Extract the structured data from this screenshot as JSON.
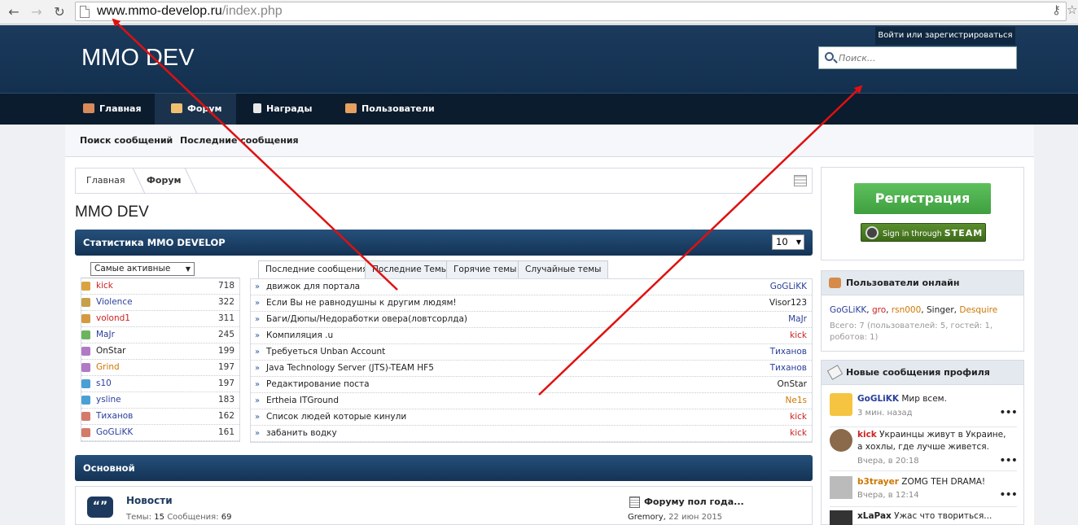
{
  "browser": {
    "url_host": "www.mmo-develop.ru",
    "url_path": "/index.php"
  },
  "header": {
    "logo": "MMO DEV",
    "login_link": "Войти или зарегистрироваться",
    "search_placeholder": "Поиск..."
  },
  "nav": {
    "tabs": [
      {
        "label": "Главная"
      },
      {
        "label": "Форум"
      },
      {
        "label": "Награды"
      },
      {
        "label": "Пользователи"
      }
    ]
  },
  "subnav": {
    "items": [
      "Поиск сообщений",
      "Последние сообщения"
    ]
  },
  "breadcrumb": {
    "items": [
      "Главная",
      "Форум"
    ]
  },
  "page_title": "MMO DEV",
  "stats": {
    "title": "Статистика MMO DEVELOP",
    "per_page": "10",
    "select_value": "Самые активные",
    "users": [
      {
        "name": "kick",
        "count": "718",
        "color": "#cc2222",
        "icon": "#d9a440"
      },
      {
        "name": "Violence",
        "count": "322",
        "color": "#2a3f9a",
        "icon": "#c7a04a"
      },
      {
        "name": "volond1",
        "count": "311",
        "color": "#cc2222",
        "icon": "#d59a40"
      },
      {
        "name": "MaJr",
        "count": "245",
        "color": "#2a3f9a",
        "icon": "#6cb45e"
      },
      {
        "name": "OnStar",
        "count": "199",
        "color": "#222222",
        "icon": "#b07ac4"
      },
      {
        "name": "Grind",
        "count": "197",
        "color": "#cc7700",
        "icon": "#b07ac4"
      },
      {
        "name": "s10",
        "count": "197",
        "color": "#2a3f9a",
        "icon": "#4aa0d4"
      },
      {
        "name": "ysline",
        "count": "183",
        "color": "#2a3f9a",
        "icon": "#4aa0d4"
      },
      {
        "name": "Тиханов",
        "count": "162",
        "color": "#2a3f9a",
        "icon": "#d47a6a"
      },
      {
        "name": "GoGLiKK",
        "count": "161",
        "color": "#2a3f9a",
        "icon": "#d47a6a"
      }
    ],
    "tabs": [
      "Последние сообщения",
      "Последние Темы",
      "Горячие темы",
      "Случайные темы"
    ],
    "threads": [
      {
        "title": "движок для портала",
        "author": "GoGLiKK",
        "color": "#2a3f9a"
      },
      {
        "title": "Если Вы не равнодушны к другим людям!",
        "author": "Visor123",
        "color": "#222222"
      },
      {
        "title": "Баги/Дюпы/Недоработки овера(ловтсорлда)",
        "author": "MaJr",
        "color": "#2a3f9a"
      },
      {
        "title": "Компиляция .u",
        "author": "kick",
        "color": "#cc2222"
      },
      {
        "title": "Требуеться Unban Account",
        "author": "Тиханов",
        "color": "#2a3f9a"
      },
      {
        "title": "Java Technology Server (JTS)-TEAM HF5",
        "author": "Тиханов",
        "color": "#2a3f9a"
      },
      {
        "title": "Редактирование поста",
        "author": "OnStar",
        "color": "#222222"
      },
      {
        "title": "Ertheia ITGround",
        "author": "Ne1s",
        "color": "#cc7700"
      },
      {
        "title": "Список людей которые кинули",
        "author": "kick",
        "color": "#cc2222"
      },
      {
        "title": "забанить водку",
        "author": "kick",
        "color": "#cc2222"
      }
    ]
  },
  "main_section": {
    "title": "Основной",
    "forum": {
      "name": "Новости",
      "topics_label": "Темы:",
      "topics": "15",
      "posts_label": "Сообщения:",
      "posts": "69",
      "last_title": "Форуму пол года...",
      "last_author": "Gremory,",
      "last_date": "22 июн 2015"
    }
  },
  "sidebar": {
    "register": "Регистрация",
    "steam_prefix": "Sign in through",
    "steam_brand": "STEAM",
    "online": {
      "title": "Пользователи онлайн",
      "users": [
        {
          "name": "GoGLiKK",
          "color": "#2a3f9a"
        },
        {
          "name": "gro",
          "color": "#cc2222"
        },
        {
          "name": "rsn000",
          "color": "#cc7700"
        },
        {
          "name": "Singer",
          "color": "#222222"
        },
        {
          "name": "Desquire",
          "color": "#cc7700"
        }
      ],
      "summary": "Всего: 7 (пользователей: 5, гостей: 1, роботов: 1)"
    },
    "profile_posts": {
      "title": "Новые сообщения профиля",
      "items": [
        {
          "author": "GoGLiKK",
          "text": "Мир всем.",
          "time": "3 мин. назад",
          "color": "#2a3f9a"
        },
        {
          "author": "kick",
          "text": "Украинцы живут в Украине, а хохлы, где лучше живется.",
          "time": "Вчера, в 20:18",
          "color": "#cc2222"
        },
        {
          "author": "b3trayer",
          "text": "ZOMG TEH DRAMA!",
          "time": "Вчера, в 12:14",
          "color": "#cc7700"
        },
        {
          "author": "xLaPax",
          "text": "Ужас что твориться...",
          "time": "",
          "color": "#222222"
        }
      ]
    }
  }
}
